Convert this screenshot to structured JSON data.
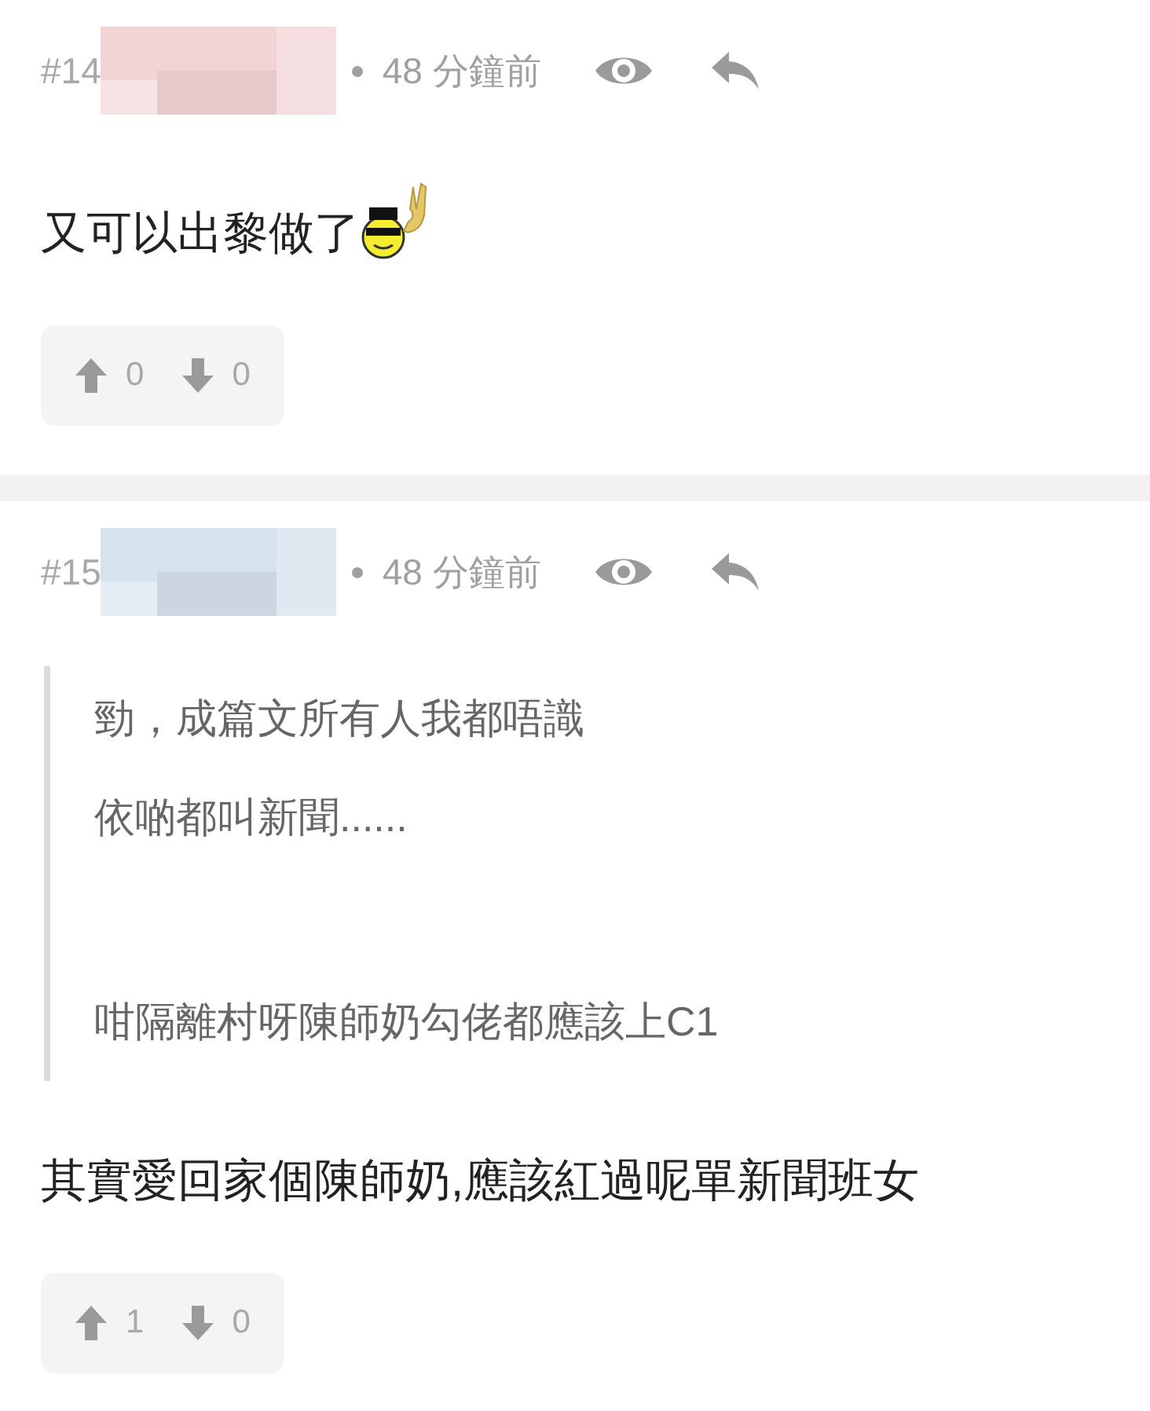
{
  "posts": [
    {
      "number": "#14",
      "color": "#f2d4d6",
      "time": "48 分鐘前",
      "body": "又可以出黎做了",
      "emoji": true,
      "votes": {
        "up": "0",
        "down": "0"
      }
    },
    {
      "number": "#15",
      "color": "#d6e2ee",
      "time": "48 分鐘前",
      "quote": [
        [
          "勁，成篇文所有人我都唔識",
          "依啲都叫新聞......"
        ],
        [
          "咁隔離村呀陳師奶勾佬都應該上C1"
        ]
      ],
      "body": "其實愛回家個陳師奶,應該紅過呢單新聞班女",
      "emoji": false,
      "votes": {
        "up": "1",
        "down": "0"
      }
    }
  ]
}
